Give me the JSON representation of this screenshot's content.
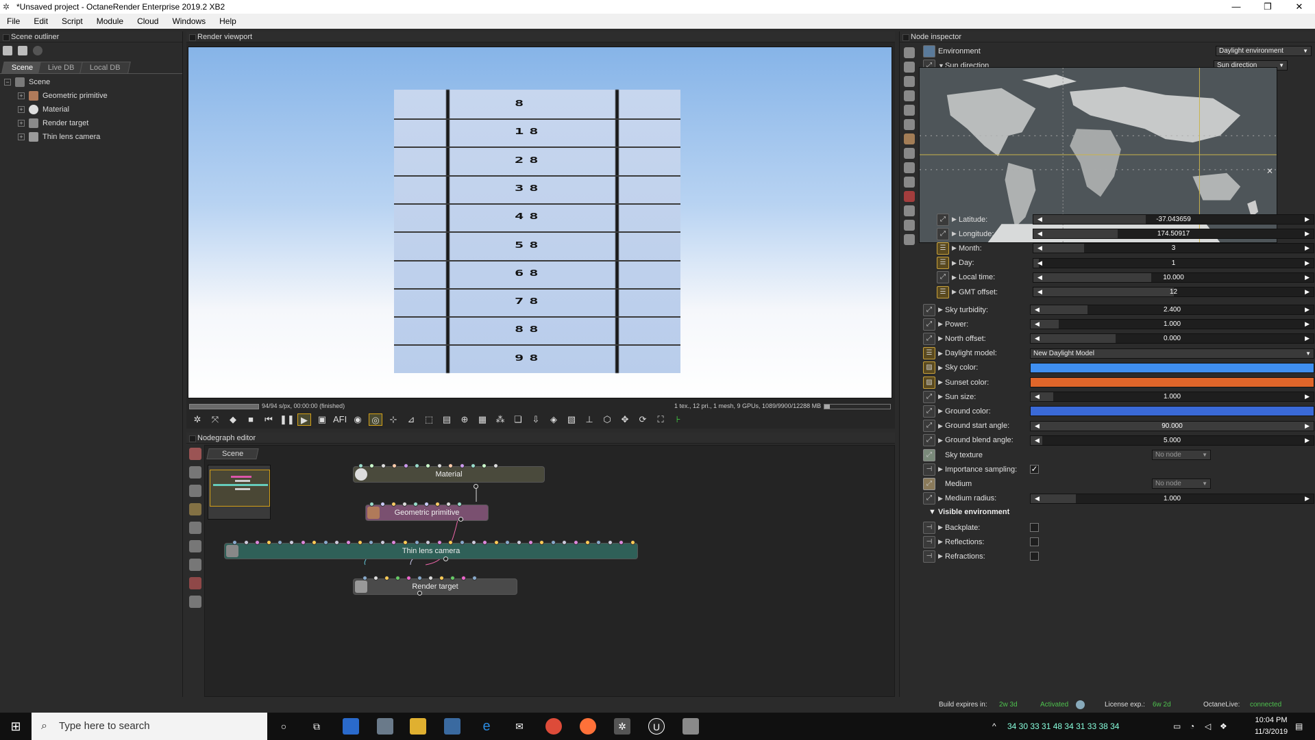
{
  "window": {
    "title": "*Unsaved project - OctaneRender Enterprise 2019.2 XB2"
  },
  "menu": [
    "File",
    "Edit",
    "Script",
    "Module",
    "Cloud",
    "Windows",
    "Help"
  ],
  "outliner": {
    "header": "Scene outliner",
    "tabs": [
      "Scene",
      "Live DB",
      "Local DB"
    ],
    "root": "Scene",
    "items": [
      "Geometric primitive",
      "Material",
      "Render target",
      "Thin lens camera"
    ]
  },
  "viewport": {
    "header": "Render viewport",
    "chart_labels": [
      "8",
      "18",
      "28",
      "38",
      "48",
      "58",
      "68",
      "78",
      "88",
      "98"
    ],
    "status_left": "94/94 s/px, 00:00:00 (finished)",
    "status_right": "1 tex., 12 pri., 1 mesh, 9 GPUs, 1089/9900/12288 MB",
    "toolbar_label": "AFI"
  },
  "nodegraph": {
    "header": "Nodegraph editor",
    "tab": "Scene",
    "nodes": {
      "material": "Material",
      "geo": "Geometric primitive",
      "camera": "Thin lens camera",
      "render": "Render target"
    }
  },
  "inspector": {
    "header": "Node inspector",
    "env_label": "Environment",
    "env_value": "Daylight environment",
    "sun_direction_label": "Sun direction",
    "sun_direction_value": "Sun direction",
    "sun": {
      "latitude": {
        "label": "Latitude:",
        "value": "-37.043659"
      },
      "longitude": {
        "label": "Longitude:",
        "value": "174.50917"
      },
      "month": {
        "label": "Month:",
        "value": "3"
      },
      "day": {
        "label": "Day:",
        "value": "1"
      },
      "local_time": {
        "label": "Local time:",
        "value": "10.000"
      },
      "gmt_offset": {
        "label": "GMT offset:",
        "value": "12"
      }
    },
    "params": {
      "sky_turbidity": {
        "label": "Sky turbidity:",
        "value": "2.400"
      },
      "power": {
        "label": "Power:",
        "value": "1.000"
      },
      "north_offset": {
        "label": "North offset:",
        "value": "0.000"
      },
      "daylight_model": {
        "label": "Daylight model:",
        "value": "New Daylight Model"
      },
      "sky_color": {
        "label": "Sky color:"
      },
      "sunset_color": {
        "label": "Sunset color:"
      },
      "sun_size": {
        "label": "Sun size:",
        "value": "1.000"
      },
      "ground_color": {
        "label": "Ground color:"
      },
      "ground_start_angle": {
        "label": "Ground start angle:",
        "value": "90.000"
      },
      "ground_blend_angle": {
        "label": "Ground blend angle:",
        "value": "5.000"
      },
      "sky_texture": {
        "label": "Sky texture",
        "value": "No node"
      },
      "importance_sampling": {
        "label": "Importance sampling:"
      },
      "medium": {
        "label": "Medium",
        "value": "No node"
      },
      "medium_radius": {
        "label": "Medium radius:",
        "value": "1.000"
      }
    },
    "visible_env": {
      "header": "Visible environment",
      "backplate": "Backplate:",
      "reflections": "Reflections:",
      "refractions": "Refractions:"
    },
    "colors": {
      "sky": "#3f8ff0",
      "sunset": "#e0662a",
      "ground": "#3a6ad8"
    }
  },
  "statusbar": {
    "build_label": "Build expires in:",
    "build_value": "2w 3d",
    "activated": "Activated",
    "license_label": "License exp.:",
    "license_value": "6w 2d",
    "live_label": "OctaneLive:",
    "live_value": "connected"
  },
  "taskbar": {
    "search_placeholder": "Type here to search",
    "tray_numbers": "34  30  33  31  48  34  31  33  38  34",
    "time": "10:04 PM",
    "date": "11/3/2019"
  }
}
